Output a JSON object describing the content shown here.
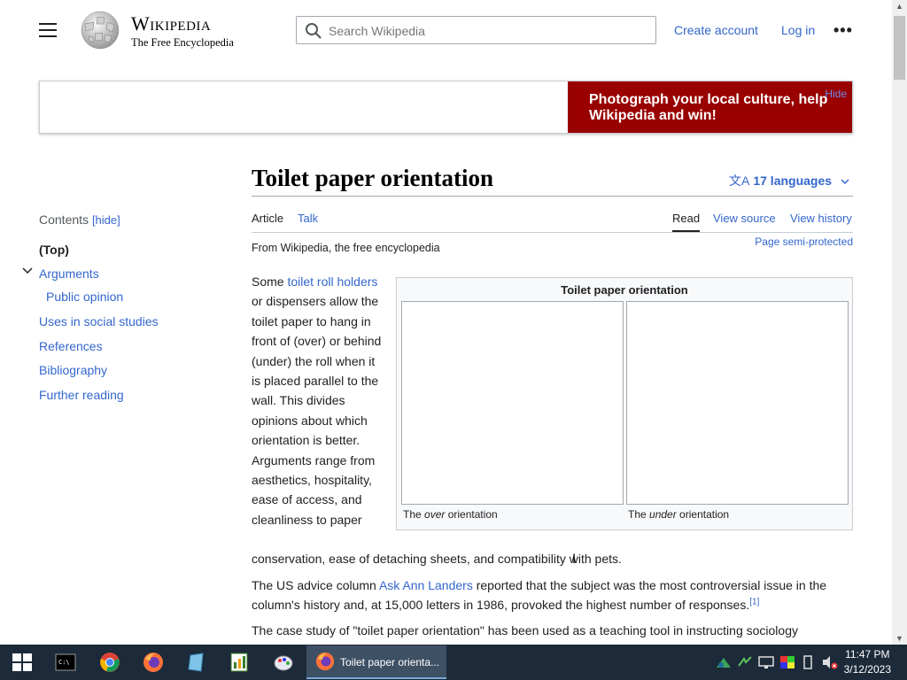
{
  "header": {
    "wordmark_title": "Wikipedia",
    "wordmark_tagline": "The Free Encyclopedia",
    "search_placeholder": "Search Wikipedia",
    "create_account": "Create account",
    "log_in": "Log in",
    "more": "•••"
  },
  "banner": {
    "text": "Photograph your local culture, help Wikipedia and win!",
    "hide": "Hide",
    "color": "#990000"
  },
  "toc": {
    "title": "Contents",
    "hide": "[hide]",
    "items": [
      {
        "label": "(Top)"
      },
      {
        "label": "Arguments"
      },
      {
        "label": "Public opinion"
      },
      {
        "label": "Uses in social studies"
      },
      {
        "label": "References"
      },
      {
        "label": "Bibliography"
      },
      {
        "label": "Further reading"
      }
    ]
  },
  "article": {
    "title": "Toilet paper orientation",
    "languages": "17 languages",
    "tabs": {
      "article": "Article",
      "talk": "Talk",
      "read": "Read",
      "view_source": "View source",
      "view_history": "View history"
    },
    "from": "From Wikipedia, the free encyclopedia",
    "semi_protected": "Page semi-protected",
    "p1_a": "Some ",
    "p1_link": "toilet roll holders",
    "p1_b": " or dispensers allow the toilet paper to hang in front of (over) or behind (under) the roll when it is placed parallel to the wall. This divides opinions about which orientation is better. Arguments range from aesthetics, hospitality, ease of access, and cleanliness to paper",
    "p1_c": "conservation, ease of detaching sheets, and compatibility with pets.",
    "p2_a": "The US advice column ",
    "p2_link": "Ask Ann Landers",
    "p2_b": " reported that the subject was the most controversial issue in the column's history and, at 15,000 letters in 1986, provoked the highest number of responses.",
    "p2_ref": "[1]",
    "p3": "The case study of \"toilet paper orientation\" has been used as a teaching tool in instructing sociology",
    "infobox_title": "Toilet paper orientation",
    "cap_left_a": "The ",
    "cap_left_em": "over",
    "cap_left_b": " orientation",
    "cap_right_a": "The ",
    "cap_right_em": "under",
    "cap_right_b": " orientation"
  },
  "taskbar": {
    "active_task": "Toilet paper orienta...",
    "time": "11:47 PM",
    "date": "3/12/2023"
  }
}
